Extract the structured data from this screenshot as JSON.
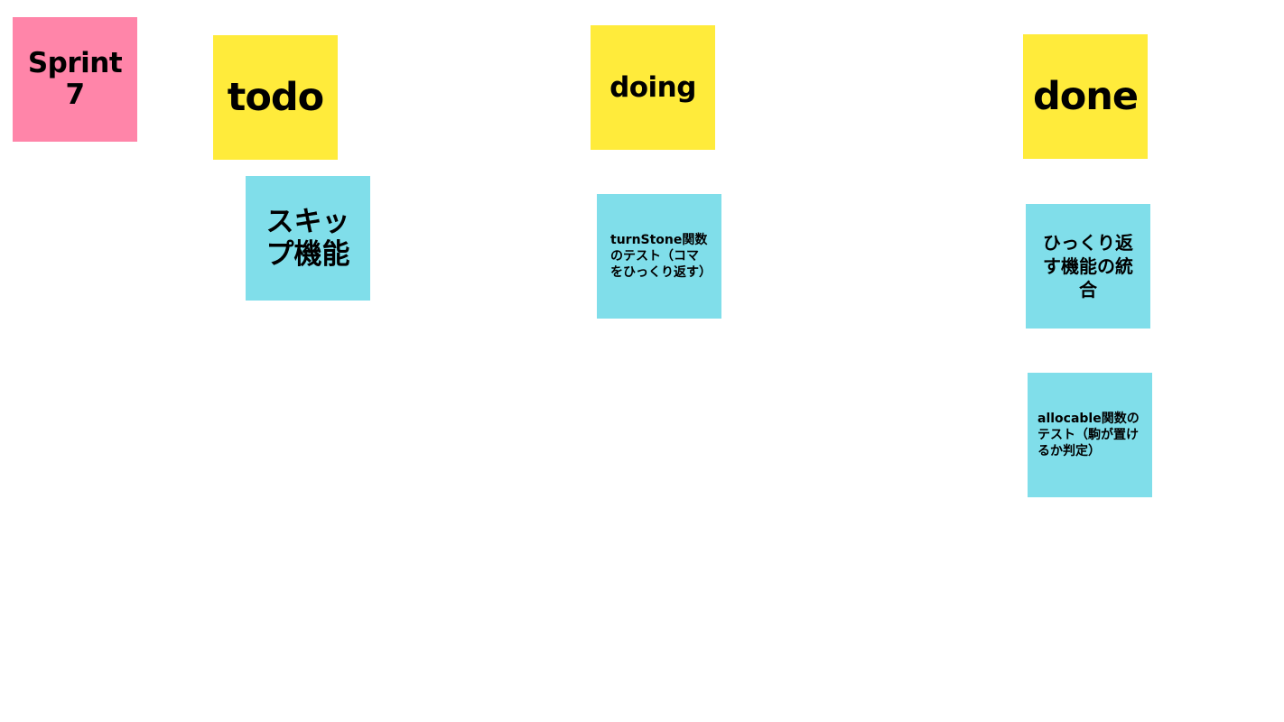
{
  "colors": {
    "background": "#ffffff",
    "pink_note": "#ff85a9",
    "yellow_note": "#ffeb3b",
    "cyan_note": "#80deea",
    "text": "#000000"
  },
  "board": {
    "sprint_note": {
      "text": "Sprint 7",
      "color": "#ff85a9"
    },
    "columns": {
      "todo": {
        "header": {
          "text": "todo",
          "color": "#ffeb3b"
        },
        "cards": [
          {
            "text": "スキップ機能",
            "color": "#80deea"
          }
        ]
      },
      "doing": {
        "header": {
          "text": "doing",
          "color": "#ffeb3b"
        },
        "cards": [
          {
            "text": "turnStone関数のテスト（コマをひっくり返す）",
            "color": "#80deea"
          }
        ]
      },
      "done": {
        "header": {
          "text": "done",
          "color": "#ffeb3b"
        },
        "cards": [
          {
            "text": "ひっくり返す機能の統合",
            "color": "#80deea"
          },
          {
            "text": "allocable関数のテスト（駒が置けるか判定）",
            "color": "#80deea"
          }
        ]
      }
    }
  }
}
